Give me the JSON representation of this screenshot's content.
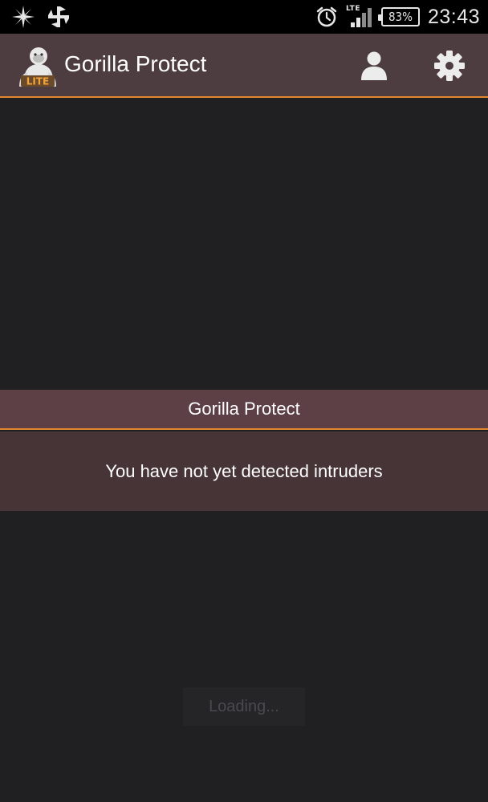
{
  "status_bar": {
    "network_type": "LTE",
    "battery_percent": "83%",
    "time": "23:43",
    "icons": [
      "pinwheel-icon",
      "cross-arrows-icon",
      "alarm-clock-icon",
      "signal-icon",
      "battery-icon"
    ]
  },
  "action_bar": {
    "logo_badge": "LITE",
    "title": "Gorilla Protect",
    "icons": [
      "gorilla-logo",
      "profile-icon",
      "settings-gear-icon"
    ]
  },
  "dialog": {
    "title": "Gorilla Protect",
    "message": "You have not yet detected intruders"
  },
  "loading": {
    "label": "Loading..."
  },
  "colors": {
    "status_bar_bg": "#000000",
    "action_bar_bg": "#4d3d40",
    "accent_orange": "#e2862f",
    "screen_bg": "#202022",
    "dialog_header_bg": "#5c4045",
    "dialog_body_bg": "#473437"
  }
}
